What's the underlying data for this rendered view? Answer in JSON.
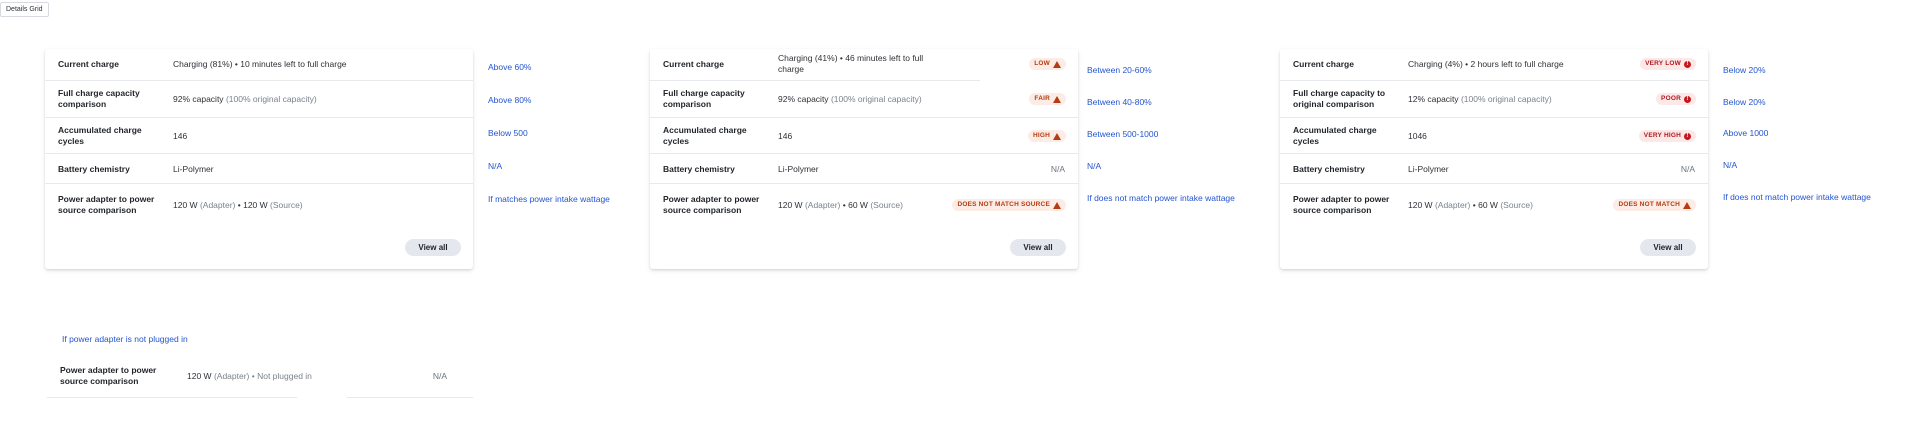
{
  "frame_tab": "Details Grid",
  "cards": [
    {
      "rows": [
        {
          "label": "Current charge",
          "value": "Charging (81%)  •  10 minutes left to full charge"
        },
        {
          "label": "Full charge capacity comparison",
          "value_main": "92% capacity",
          "value_muted": "(100% original capacity)"
        },
        {
          "label": "Accumulated charge cycles",
          "value": "146"
        },
        {
          "label": "Battery chemistry",
          "value": "Li-Polymer"
        },
        {
          "label": "Power adapter to power source comparison",
          "value_main": "120 W",
          "value_muted_a": "(Adapter)",
          "value_mid": " • 120 W",
          "value_muted_b": "(Source)"
        }
      ],
      "button": "View all",
      "notes": [
        "Above 60%",
        "Above 80%",
        "Below 500",
        "N/A",
        "If matches power intake wattage"
      ]
    },
    {
      "rows": [
        {
          "label": "Current charge",
          "value": "Charging (41%)  •  46 minutes left to full charge",
          "badge": "LOW"
        },
        {
          "label": "Full charge capacity comparison",
          "value_main": "92% capacity",
          "value_muted": "(100% original capacity)",
          "badge": "FAIR"
        },
        {
          "label": "Accumulated charge cycles",
          "value": "146",
          "badge": "HIGH"
        },
        {
          "label": "Battery chemistry",
          "value": "Li-Polymer",
          "na": "N/A"
        },
        {
          "label": "Power adapter to power source comparison",
          "value_main": "120 W",
          "value_muted_a": "(Adapter)",
          "value_mid": " • 60 W",
          "value_muted_b": "(Source)",
          "badge": "DOES NOT MATCH SOURCE"
        }
      ],
      "button": "View all",
      "notes": [
        "Between 20-60%",
        "Between 40-80%",
        "Between 500-1000",
        "N/A",
        "If does not match power intake wattage"
      ]
    },
    {
      "rows": [
        {
          "label": "Current charge",
          "value": "Charging (4%)  •  2 hours left to full charge",
          "badge": "VERY LOW"
        },
        {
          "label": "Full charge capacity to original comparison",
          "value_main": "12% capacity",
          "value_muted": "(100% original capacity)",
          "badge": "POOR"
        },
        {
          "label": "Accumulated charge cycles",
          "value": "1046",
          "badge": "VERY HIGH"
        },
        {
          "label": "Battery chemistry",
          "value": "Li-Polymer",
          "na": "N/A"
        },
        {
          "label": "Power adapter to power source comparison",
          "value_main": "120 W",
          "value_muted_a": "(Adapter)",
          "value_mid": " • 60 W",
          "value_muted_b": "(Source)",
          "badge": "DOES NOT MATCH"
        }
      ],
      "button": "View all",
      "notes": [
        "Below 20%",
        "Below 20%",
        "Above 1000",
        "N/A",
        "If does not match power intake wattage"
      ]
    }
  ],
  "extra": {
    "note": "If power adapter is not plugged in",
    "label": "Power adapter to power source comparison",
    "value_main": "120 W",
    "value_muted": "(Adapter)",
    "value_rest": " • Not plugged in",
    "na": "N/A"
  },
  "colors": {
    "link": "#2454d1",
    "badge_orange_bg": "#fdece6",
    "badge_orange_fg": "#b43d12",
    "badge_red_bg": "#fde8e8",
    "badge_red_fg": "#b0191f"
  }
}
